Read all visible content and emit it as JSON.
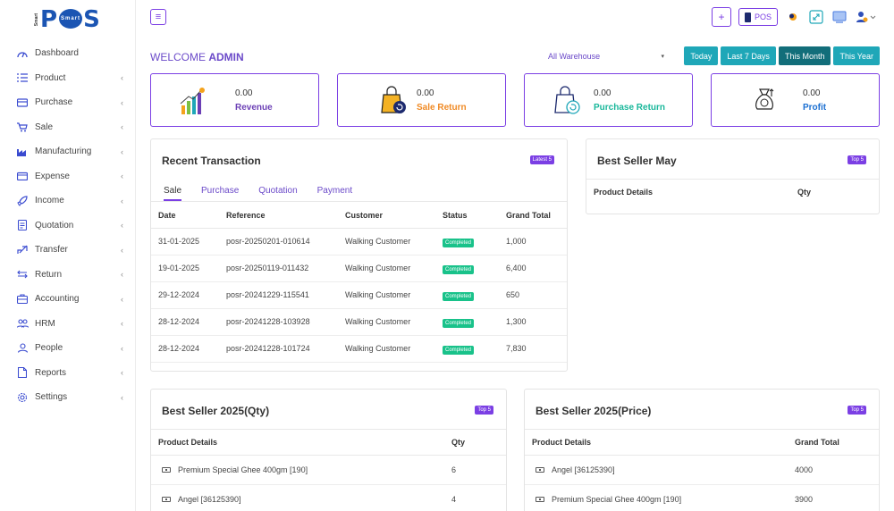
{
  "brand": {
    "small": "Smart",
    "name": "POS",
    "badge": "Smart"
  },
  "nav": [
    {
      "label": "Dashboard",
      "icon": "dashboard-icon",
      "chevron": false
    },
    {
      "label": "Product",
      "icon": "list-icon",
      "chevron": true
    },
    {
      "label": "Purchase",
      "icon": "card-icon",
      "chevron": true
    },
    {
      "label": "Sale",
      "icon": "cart-icon",
      "chevron": true
    },
    {
      "label": "Manufacturing",
      "icon": "factory-icon",
      "chevron": true
    },
    {
      "label": "Expense",
      "icon": "wallet-icon",
      "chevron": true
    },
    {
      "label": "Income",
      "icon": "rocket-icon",
      "chevron": true
    },
    {
      "label": "Quotation",
      "icon": "document-icon",
      "chevron": true
    },
    {
      "label": "Transfer",
      "icon": "transfer-icon",
      "chevron": true
    },
    {
      "label": "Return",
      "icon": "return-icon",
      "chevron": true
    },
    {
      "label": "Accounting",
      "icon": "briefcase-icon",
      "chevron": true
    },
    {
      "label": "HRM",
      "icon": "users-icon",
      "chevron": true
    },
    {
      "label": "People",
      "icon": "person-icon",
      "chevron": true
    },
    {
      "label": "Reports",
      "icon": "file-icon",
      "chevron": true
    },
    {
      "label": "Settings",
      "icon": "gear-icon",
      "chevron": true
    }
  ],
  "topbar": {
    "menu": "≡",
    "plus": "+",
    "pos": "POS"
  },
  "welcome": {
    "prefix": "WELCOME ",
    "user": "ADMIN"
  },
  "warehouse": {
    "value": "All Warehouse"
  },
  "range": {
    "today": "Today",
    "last7": "Last 7 Days",
    "month": "This Month",
    "year": "This Year"
  },
  "stats": [
    {
      "value": "0.00",
      "label": "Revenue",
      "color": "#6b3fb5"
    },
    {
      "value": "0.00",
      "label": "Sale Return",
      "color": "#f08a24"
    },
    {
      "value": "0.00",
      "label": "Purchase Return",
      "color": "#18b79a"
    },
    {
      "value": "0.00",
      "label": "Profit",
      "color": "#1b6fd1"
    }
  ],
  "recent": {
    "title": "Recent Transaction",
    "badge": "Latest 5",
    "tabs": [
      "Sale",
      "Purchase",
      "Quotation",
      "Payment"
    ],
    "headers": [
      "Date",
      "Reference",
      "Customer",
      "Status",
      "Grand Total"
    ],
    "rows": [
      [
        "31-01-2025",
        "posr-20250201-010614",
        "Walking Customer",
        "Completed",
        "1,000"
      ],
      [
        "19-01-2025",
        "posr-20250119-011432",
        "Walking Customer",
        "Completed",
        "6,400"
      ],
      [
        "29-12-2024",
        "posr-20241229-115541",
        "Walking Customer",
        "Completed",
        "650"
      ],
      [
        "28-12-2024",
        "posr-20241228-103928",
        "Walking Customer",
        "Completed",
        "1,300"
      ],
      [
        "28-12-2024",
        "posr-20241228-101724",
        "Walking Customer",
        "Completed",
        "7,830"
      ]
    ]
  },
  "best_may": {
    "title": "Best Seller May",
    "badge": "Top 5",
    "headers": [
      "Product Details",
      "Qty"
    ]
  },
  "best_qty": {
    "title": "Best Seller 2025(Qty)",
    "badge": "Top 5",
    "headers": [
      "Product Details",
      "Qty"
    ],
    "rows": [
      [
        "Premium Special Ghee 400gm [190]",
        "6"
      ],
      [
        "Angel [36125390]",
        "4"
      ]
    ]
  },
  "best_price": {
    "title": "Best Seller 2025(Price)",
    "badge": "Top 5",
    "headers": [
      "Product Details",
      "Grand Total"
    ],
    "rows": [
      [
        "Angel [36125390]",
        "4000"
      ],
      [
        "Premium Special Ghee 400gm [190]",
        "3900"
      ]
    ]
  }
}
